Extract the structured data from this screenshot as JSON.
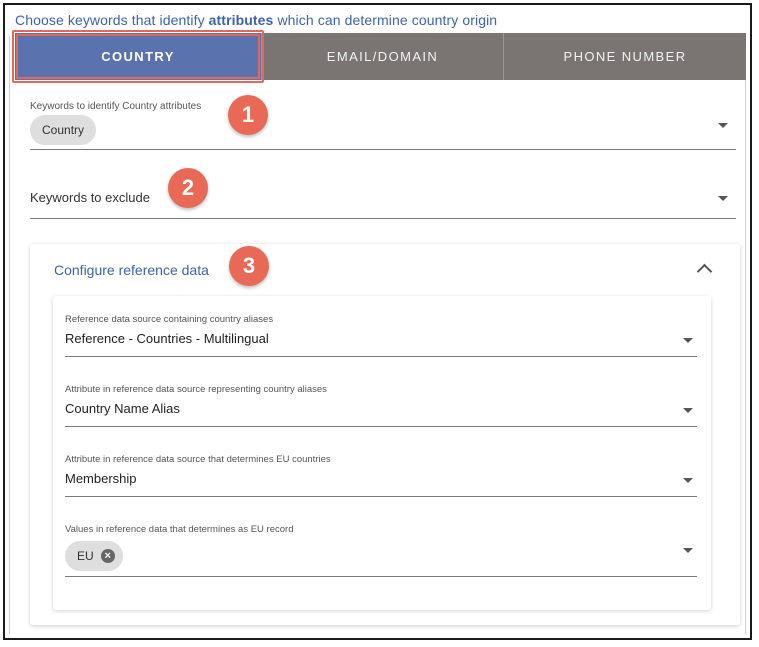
{
  "heading": {
    "pre": "Choose keywords that identify ",
    "bold": "attributes",
    "post": " which can determine country origin"
  },
  "tabs": [
    {
      "label": "COUNTRY",
      "active": true
    },
    {
      "label": "EMAIL/DOMAIN",
      "active": false
    },
    {
      "label": "PHONE NUMBER",
      "active": false
    }
  ],
  "country_keywords": {
    "label": "Keywords to identify Country attributes",
    "chips": [
      "Country"
    ]
  },
  "exclude_keywords": {
    "label": "Keywords to exclude"
  },
  "badges": [
    "1",
    "2",
    "3"
  ],
  "reference": {
    "title": "Configure reference data",
    "fields": [
      {
        "label": "Reference data source containing country aliases",
        "value": "Reference - Countries - Multilingual"
      },
      {
        "label": "Attribute in reference data source representing country aliases",
        "value": "Country Name Alias"
      },
      {
        "label": "Attribute in reference data source that determines EU countries",
        "value": "Membership"
      },
      {
        "label": "Values in reference data that determines as EU record",
        "chips": [
          "EU"
        ]
      }
    ]
  },
  "icons": {
    "dropdown": "caret-down-icon",
    "collapse": "chevron-up-icon",
    "chip_remove": "close-circle-icon"
  },
  "colors": {
    "accent": "#3b62b3",
    "active_tab": "#5a72ad",
    "tab_bar": "#7a7572",
    "highlight": "#e1685a",
    "badge": "#e86a56"
  }
}
